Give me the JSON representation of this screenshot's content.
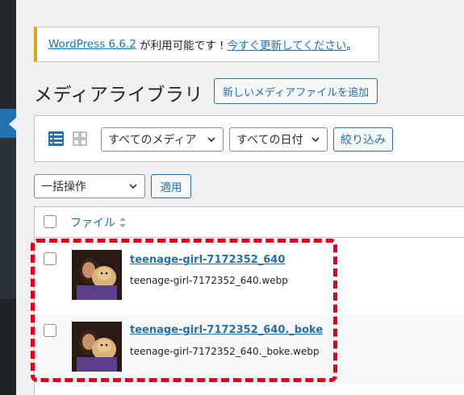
{
  "notice": {
    "link_version": "WordPress 6.6.2",
    "middle_text": " が利用可能です ! ",
    "link_update": "今すぐ更新してください",
    "end_text": "。"
  },
  "page": {
    "title": "メディアライブラリ",
    "add_new_label": "新しいメディアファイルを追加"
  },
  "filters": {
    "view_list_icon": "list-view-icon",
    "view_grid_icon": "grid-view-icon",
    "media_type": "すべてのメディア",
    "date": "すべての日付",
    "filter_button": "絞り込み"
  },
  "bulk": {
    "action": "一括操作",
    "apply_button": "適用"
  },
  "table": {
    "column_file": "ファイル",
    "rows": [
      {
        "title": "teenage-girl-7172352_640",
        "filename": "teenage-girl-7172352_640.webp"
      },
      {
        "title": "teenage-girl-7172352_640._boke",
        "filename": "teenage-girl-7172352_640._boke.webp"
      }
    ]
  },
  "colors": {
    "accent": "#2271b1",
    "notice_border": "#dba617",
    "highlight": "#e0001b",
    "sidebar": "#1d2327"
  }
}
